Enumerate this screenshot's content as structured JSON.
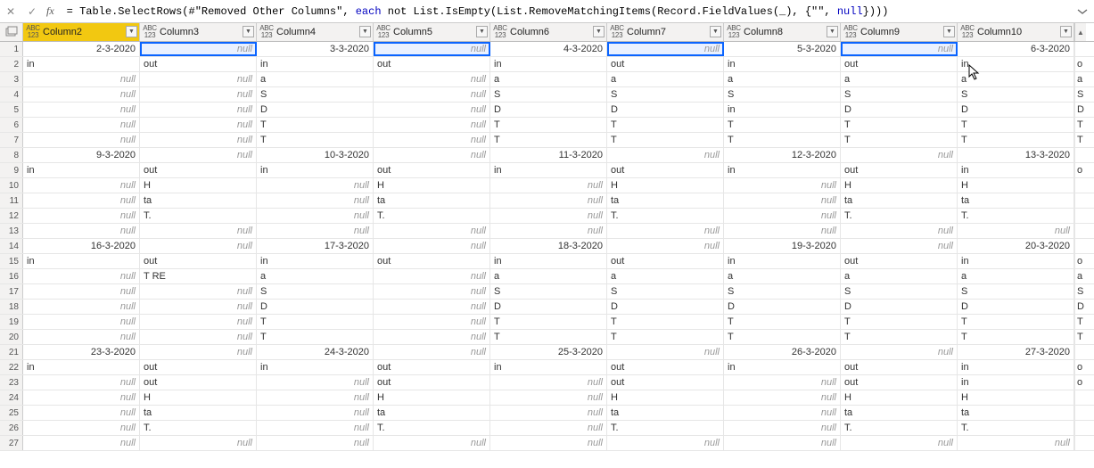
{
  "formula": {
    "prefix": "= Table.SelectRows(#\"Removed Other Columns\", ",
    "kw1": "each",
    "mid1": " not List.IsEmpty(List.RemoveMatchingItems(Record.FieldValues(_), {\"\", ",
    "kw2": "null",
    "suffix": "})))"
  },
  "columns": [
    {
      "name": "Column2",
      "w": 131,
      "selected": true
    },
    {
      "name": "Column3",
      "w": 131,
      "selected": false
    },
    {
      "name": "Column4",
      "w": 131,
      "selected": false
    },
    {
      "name": "Column5",
      "w": 131,
      "selected": false
    },
    {
      "name": "Column6",
      "w": 131,
      "selected": false
    },
    {
      "name": "Column7",
      "w": 131,
      "selected": false
    },
    {
      "name": "Column8",
      "w": 131,
      "selected": false
    },
    {
      "name": "Column9",
      "w": 131,
      "selected": false
    },
    {
      "name": "Column10",
      "w": 131,
      "selected": false
    }
  ],
  "type_icon": {
    "abc": "ABC",
    "num": "123"
  },
  "null_text": "null",
  "highlights": {
    "row": 0,
    "cols": [
      1,
      3,
      5,
      7
    ]
  },
  "rows": [
    {
      "n": 1,
      "c": [
        "2-3-2020",
        "null",
        "3-3-2020",
        "null",
        "4-3-2020",
        "null",
        "5-3-2020",
        "null",
        "6-3-2020"
      ],
      "tail": ""
    },
    {
      "n": 2,
      "c": [
        "in",
        "out",
        "in",
        "out",
        "in",
        "out",
        "in",
        "out",
        "in"
      ],
      "tail": "o"
    },
    {
      "n": 3,
      "c": [
        "null",
        "null",
        "a",
        "null",
        "a",
        "a",
        "a",
        "a",
        "a"
      ],
      "tail": "a"
    },
    {
      "n": 4,
      "c": [
        "null",
        "null",
        "S",
        "null",
        "S",
        "S",
        "S",
        "S",
        "S"
      ],
      "tail": "S"
    },
    {
      "n": 5,
      "c": [
        "null",
        "null",
        "D",
        "null",
        "D",
        "D",
        "in",
        "D",
        "D"
      ],
      "tail": "D"
    },
    {
      "n": 6,
      "c": [
        "null",
        "null",
        "T",
        "null",
        "T",
        "T",
        "T",
        "T",
        "T"
      ],
      "tail": "T"
    },
    {
      "n": 7,
      "c": [
        "null",
        "null",
        "T",
        "null",
        "T",
        "T",
        "T",
        "T",
        "T"
      ],
      "tail": "T"
    },
    {
      "n": 8,
      "c": [
        "9-3-2020",
        "null",
        "10-3-2020",
        "null",
        "11-3-2020",
        "null",
        "12-3-2020",
        "null",
        "13-3-2020"
      ],
      "tail": ""
    },
    {
      "n": 9,
      "c": [
        "in",
        "out",
        "in",
        "out",
        "in",
        "out",
        "in",
        "out",
        "in"
      ],
      "tail": "o"
    },
    {
      "n": 10,
      "c": [
        "null",
        "H",
        "null",
        "H",
        "null",
        "H",
        "null",
        "H",
        "H"
      ],
      "tail": ""
    },
    {
      "n": 11,
      "c": [
        "null",
        "ta",
        "null",
        "ta",
        "null",
        "ta",
        "null",
        "ta",
        "ta"
      ],
      "tail": ""
    },
    {
      "n": 12,
      "c": [
        "null",
        "T.",
        "null",
        "T.",
        "null",
        "T.",
        "null",
        "T.",
        "T."
      ],
      "tail": ""
    },
    {
      "n": 13,
      "c": [
        "null",
        "null",
        "null",
        "null",
        "null",
        "null",
        "null",
        "null",
        "null"
      ],
      "tail": ""
    },
    {
      "n": 14,
      "c": [
        "16-3-2020",
        "null",
        "17-3-2020",
        "null",
        "18-3-2020",
        "null",
        "19-3-2020",
        "null",
        "20-3-2020"
      ],
      "tail": ""
    },
    {
      "n": 15,
      "c": [
        "in",
        "out",
        "in",
        "out",
        "in",
        "out",
        "in",
        "out",
        "in"
      ],
      "tail": "o"
    },
    {
      "n": 16,
      "c": [
        "null",
        "T RE",
        "a",
        "null",
        "a",
        "a",
        "a",
        "a",
        "a"
      ],
      "tail": "a"
    },
    {
      "n": 17,
      "c": [
        "null",
        "null",
        "S",
        "null",
        "S",
        "S",
        "S",
        "S",
        "S"
      ],
      "tail": "S"
    },
    {
      "n": 18,
      "c": [
        "null",
        "null",
        "D",
        "null",
        "D",
        "D",
        "D",
        "D",
        "D"
      ],
      "tail": "D"
    },
    {
      "n": 19,
      "c": [
        "null",
        "null",
        "T",
        "null",
        "T",
        "T",
        "T",
        "T",
        "T"
      ],
      "tail": "T"
    },
    {
      "n": 20,
      "c": [
        "null",
        "null",
        "T",
        "null",
        "T",
        "T",
        "T",
        "T",
        "T"
      ],
      "tail": "T"
    },
    {
      "n": 21,
      "c": [
        "23-3-2020",
        "null",
        "24-3-2020",
        "null",
        "25-3-2020",
        "null",
        "26-3-2020",
        "null",
        "27-3-2020"
      ],
      "tail": ""
    },
    {
      "n": 22,
      "c": [
        "in",
        "out",
        "in",
        "out",
        "in",
        "out",
        "in",
        "out",
        "in"
      ],
      "tail": "o"
    },
    {
      "n": 23,
      "c": [
        "null",
        "out",
        "null",
        "out",
        "null",
        "out",
        "null",
        "out",
        "in"
      ],
      "tail": "o"
    },
    {
      "n": 24,
      "c": [
        "null",
        "H",
        "null",
        "H",
        "null",
        "H",
        "null",
        "H",
        "H"
      ],
      "tail": ""
    },
    {
      "n": 25,
      "c": [
        "null",
        "ta",
        "null",
        "ta",
        "null",
        "ta",
        "null",
        "ta",
        "ta"
      ],
      "tail": ""
    },
    {
      "n": 26,
      "c": [
        "null",
        "T.",
        "null",
        "T.",
        "null",
        "T.",
        "null",
        "T.",
        "T."
      ],
      "tail": ""
    },
    {
      "n": 27,
      "c": [
        "null",
        "null",
        "null",
        "null",
        "null",
        "null",
        "null",
        "null",
        "null"
      ],
      "tail": ""
    }
  ]
}
